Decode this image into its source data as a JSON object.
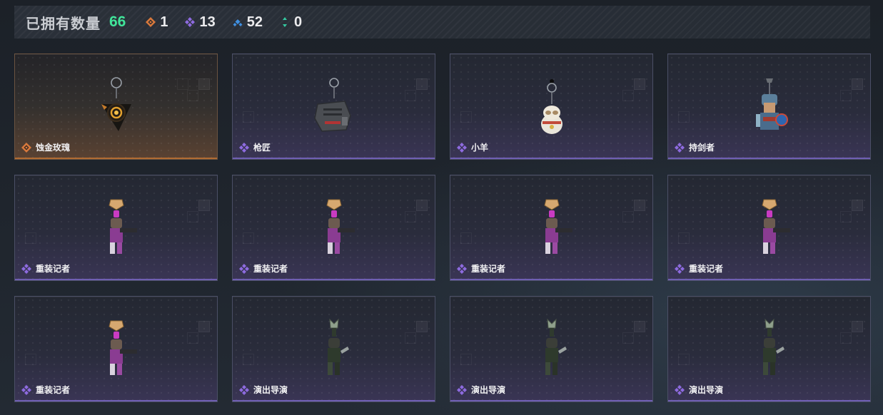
{
  "header": {
    "title": "已拥有数量",
    "total": "66",
    "stats": [
      {
        "value": "1",
        "color": "#d9793c",
        "icon": "orange-diamond-icon"
      },
      {
        "value": "13",
        "color": "#8e6be0",
        "icon": "purple-diamond-icon"
      },
      {
        "value": "52",
        "color": "#3f8fe0",
        "icon": "blue-diamond-icon"
      },
      {
        "value": "0",
        "color": "#34c9a0",
        "icon": "green-arrows-icon"
      }
    ]
  },
  "cards": [
    {
      "name": "蚀金玫瑰",
      "rarity": "gold",
      "item": "golden-rose-keychain"
    },
    {
      "name": "枪匠",
      "rarity": "purple",
      "item": "gunsmith-keychain"
    },
    {
      "name": "小羊",
      "rarity": "purple",
      "item": "lamb-keychain"
    },
    {
      "name": "持剑者",
      "rarity": "purple",
      "item": "swordbearer-keychain"
    },
    {
      "name": "重装记者",
      "rarity": "purple",
      "item": "heavy-reporter-keychain"
    },
    {
      "name": "重装记者",
      "rarity": "purple",
      "item": "heavy-reporter-keychain"
    },
    {
      "name": "重装记者",
      "rarity": "purple",
      "item": "heavy-reporter-keychain"
    },
    {
      "name": "重装记者",
      "rarity": "purple",
      "item": "heavy-reporter-keychain"
    },
    {
      "name": "重装记者",
      "rarity": "purple",
      "item": "heavy-reporter-keychain"
    },
    {
      "name": "演出导演",
      "rarity": "purple",
      "item": "show-director-keychain"
    },
    {
      "name": "演出导演",
      "rarity": "purple",
      "item": "show-director-keychain"
    },
    {
      "name": "演出导演",
      "rarity": "purple",
      "item": "show-director-keychain"
    }
  ]
}
